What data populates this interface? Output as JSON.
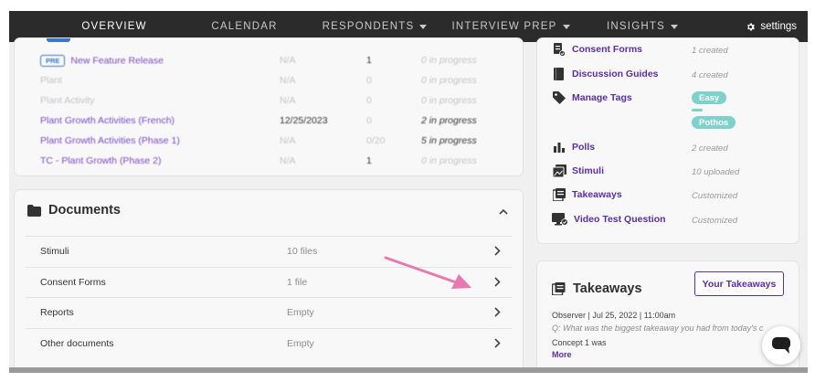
{
  "nav": {
    "tabs": [
      {
        "label": "OVERVIEW"
      },
      {
        "label": "CALENDAR"
      },
      {
        "label": "RESPONDENTS"
      },
      {
        "label": "INTERVIEW PREP"
      },
      {
        "label": "INSIGHTS"
      }
    ],
    "settings_label": "settings"
  },
  "activities": {
    "rows": [
      {
        "badge": "PRE",
        "name": "New Feature Release",
        "date": "N/A",
        "count": "1",
        "status": "0 in progress"
      },
      {
        "name": "Plant",
        "date": "N/A",
        "count": "0",
        "status": "0 in progress"
      },
      {
        "name": "Plant Activity",
        "date": "N/A",
        "count": "0",
        "status": "0 in progress"
      },
      {
        "name": "Plant Growth Activities (French)",
        "date": "12/25/2023",
        "count": "0",
        "status": "2 in progress"
      },
      {
        "name": "Plant Growth Activities (Phase 1)",
        "date": "N/A",
        "count": "0/20",
        "status": "5 in progress"
      },
      {
        "name": "TC - Plant Growth (Phase 2)",
        "date": "N/A",
        "count": "1",
        "status": "0 in progress"
      }
    ]
  },
  "documents": {
    "title": "Documents",
    "rows": [
      {
        "name": "Stimuli",
        "meta": "10 files"
      },
      {
        "name": "Consent Forms",
        "meta": "1 file"
      },
      {
        "name": "Reports",
        "meta": "Empty"
      },
      {
        "name": "Other documents",
        "meta": "Empty"
      }
    ]
  },
  "resources": {
    "consent_forms": {
      "label": "Consent Forms",
      "meta": "1 created"
    },
    "discussion_guides": {
      "label": "Discussion Guides",
      "meta": "4 created"
    },
    "manage_tags": {
      "label": "Manage Tags",
      "tags": [
        "Easy",
        "Pothos"
      ]
    },
    "polls": {
      "label": "Polls",
      "meta": "2 created"
    },
    "stimuli": {
      "label": "Stimuli",
      "meta": "10 uploaded"
    },
    "takeaways": {
      "label": "Takeaways",
      "meta": "Customized"
    },
    "video_test": {
      "label": "Video Test Question",
      "meta": "Customized"
    }
  },
  "takeaways_card": {
    "title": "Takeaways",
    "button_label": "Your Takeaways",
    "meta_line": "Observer  |  Jul 25, 2022  |  11:00am",
    "question": "Q: What was the biggest takeaway you had from today's c",
    "answer": "Concept 1 was",
    "more_label": "More"
  },
  "colors": {
    "nav_bg": "#2b2b2b",
    "active_underline": "#d94f8f",
    "link_purple": "#5b2ea6",
    "tag_teal": "#7fd1cb",
    "annotation_arrow": "#e879b0"
  }
}
